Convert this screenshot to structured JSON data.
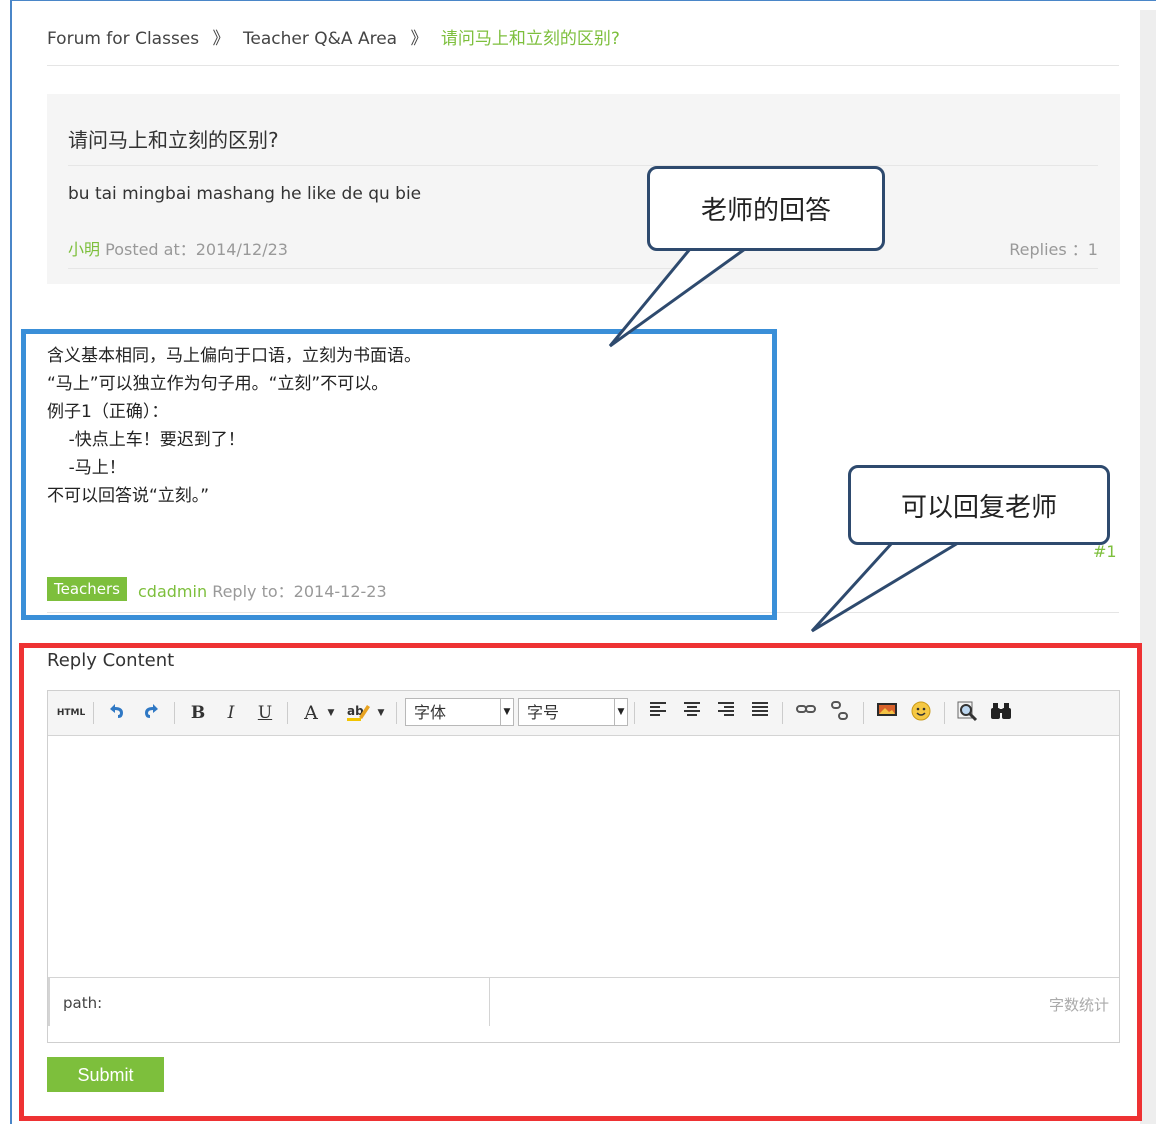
{
  "breadcrumb": {
    "items": [
      "Forum for Classes",
      "Teacher Q&A Area",
      "请问马上和立刻的区别?"
    ],
    "separator": "》"
  },
  "question": {
    "title": "请问马上和立刻的区别?",
    "body": "bu tai mingbai mashang he like de qu bie",
    "author": "小明",
    "posted_label": "Posted at：2014/12/23",
    "replies_label": "Replies ：1"
  },
  "answer": {
    "lines": [
      "含义基本相同，马上偏向于口语，立刻为书面语。",
      "“马上”可以独立作为句子用。“立刻”不可以。",
      "例子1（正确）：",
      "    -快点上车！要迟到了！",
      "    -马上！",
      "不可以回答说“立刻。”"
    ],
    "badge": "Teachers",
    "author": "cdadmin",
    "reply_label": "Reply to：2014-12-23",
    "floor": "#1"
  },
  "callouts": {
    "teacher_answer": "老师的回答",
    "can_reply": "可以回复老师"
  },
  "reply_form": {
    "label": "Reply Content",
    "toolbar": {
      "html": "HTML",
      "bold": "B",
      "italic": "I",
      "underline": "U",
      "font_color": "A",
      "font_family": "字体",
      "font_size": "字号"
    },
    "path_label": "path:",
    "word_count": "字数统计",
    "submit": "Submit"
  },
  "colors": {
    "accent_green": "#7dbf3c",
    "highlight_blue": "#3a8fd8",
    "highlight_red": "#ee3233",
    "callout_border": "#2e4a6e"
  }
}
